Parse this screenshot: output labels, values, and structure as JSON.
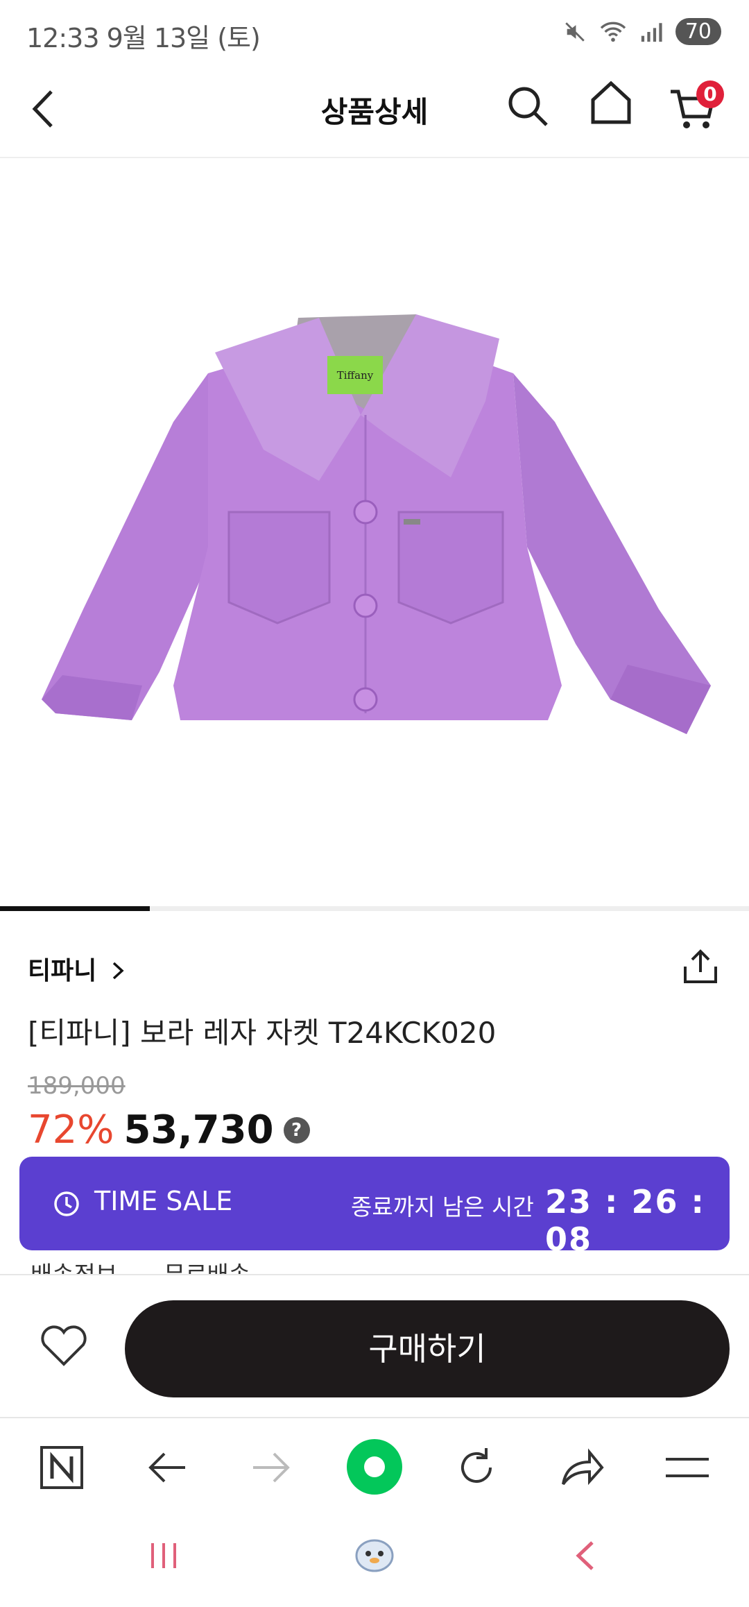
{
  "status_bar": {
    "time": "12:33",
    "date": "9월 13일 (토)",
    "battery": "70"
  },
  "header": {
    "title": "상품상세",
    "cart_count": "0"
  },
  "product": {
    "image_label": "Tiffany",
    "brand": "티파니",
    "name": "[티파니]  보라 레자 자켓 T24KCK020",
    "original_price": "189,000",
    "discount": "72%",
    "price": "53,730",
    "help_icon": "?"
  },
  "time_sale": {
    "label": "TIME SALE",
    "remaining_label": "종료까지 남은 시간",
    "countdown": "23 : 26 : 08"
  },
  "shipping_peek": {
    "label": "배송정보",
    "value": "무료배송"
  },
  "buy_bar": {
    "buy_label": "구매하기"
  },
  "image_gallery": {
    "current_fraction": 0.2
  },
  "colors": {
    "accent": "#5b3fd0",
    "discount": "#e8472f",
    "badge": "#e0203a",
    "naver_green": "#03c75a"
  },
  "icons": [
    "back-icon",
    "search-icon",
    "home-icon",
    "cart-icon",
    "chevron-right-icon",
    "share-icon",
    "clock-icon",
    "heart-icon",
    "naver-n-icon",
    "arrow-left-icon",
    "arrow-right-icon",
    "naver-green-button",
    "refresh-icon",
    "forward-share-icon",
    "menu-icon",
    "recent-apps-icon",
    "home-face-icon",
    "nav-back-icon"
  ]
}
